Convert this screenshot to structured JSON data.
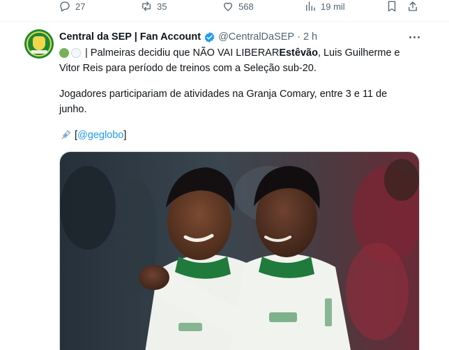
{
  "prev_actions": {
    "replies": "27",
    "reposts": "35",
    "likes": "568",
    "views": "19 mil"
  },
  "tweet": {
    "author_name": "Central da SEP | Fan Account",
    "handle": "@CentralDaSEP",
    "separator": "·",
    "time": "2 h",
    "line1_pre": "| Palmeiras decidiu que NÃO VAI LIBERAR ",
    "line1_bold": "Estêvão",
    "line1_post": ", Luis Guilherme e",
    "line2": "Vitor Reis para período de treinos com a Seleção sub-20.",
    "line3": "Jogadores participariam de atividades na Granja Comary, entre 3 e 11 de",
    "line4": "junho.",
    "source_open": "[",
    "source_link": "@geglobo",
    "source_close": "]"
  },
  "icons": {
    "reply": "reply-icon",
    "repost": "repost-icon",
    "like": "heart-icon",
    "views": "views-icon",
    "bookmark": "bookmark-icon",
    "share": "share-icon",
    "verified": "verified-badge-icon",
    "syringe": "syringe-icon",
    "more": "more-icon"
  },
  "colors": {
    "text": "#0f1419",
    "muted": "#536471",
    "link": "#1d9bf0",
    "verified": "#1d9bf0",
    "kit_white": "#f1f3ee",
    "kit_green": "#1f7a3c"
  }
}
